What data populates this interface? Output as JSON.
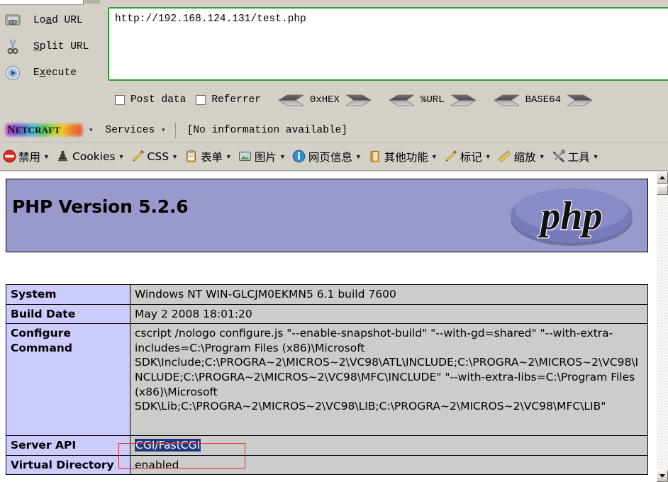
{
  "hackbar": {
    "actions": [
      {
        "icon": "load-url-icon",
        "label_pre": "Lo",
        "label_key": "a",
        "label_post": "d URL",
        "full": "Load URL"
      },
      {
        "icon": "split-url-scissors-icon",
        "label_pre": "",
        "label_key": "S",
        "label_post": "plit URL",
        "full": "Split URL"
      },
      {
        "icon": "execute-play-icon",
        "label_pre": "E",
        "label_key": "x",
        "label_post": "ecute",
        "full": "Execute"
      }
    ],
    "url_value": "http://192.168.124.131/test.php",
    "options": [
      {
        "label": "Post data",
        "checked": false
      },
      {
        "label": "Referrer",
        "checked": false
      }
    ],
    "encoders": [
      {
        "label": "0xHEX"
      },
      {
        "label": "%URL"
      },
      {
        "label": "BASE64"
      }
    ]
  },
  "netcraft": {
    "brand_first": "N",
    "brand_rest": "ETCRAFT",
    "menu": "Services",
    "status": "[No information available]"
  },
  "webdev_toolbar": {
    "items": [
      {
        "icon": "disable-prohibited-icon",
        "label": "禁用"
      },
      {
        "icon": "cookies-stamp-icon",
        "label": "Cookies"
      },
      {
        "icon": "css-pencil-icon",
        "label": "CSS"
      },
      {
        "icon": "forms-clipboard-icon",
        "label": "表单"
      },
      {
        "icon": "images-picture-icon",
        "label": "图片"
      },
      {
        "icon": "page-info-icon",
        "label": "网页信息"
      },
      {
        "icon": "misc-book-icon",
        "label": "其他功能"
      },
      {
        "icon": "outline-pencil-icon",
        "label": "标记"
      },
      {
        "icon": "resize-ruler-icon",
        "label": "缩放"
      },
      {
        "icon": "tools-wrench-icon",
        "label": "工具"
      }
    ]
  },
  "phpinfo": {
    "banner_title": "PHP Version 5.2.6",
    "logo_text": "php",
    "rows": [
      {
        "key": "System",
        "value": "Windows NT WIN-GLCJM0EKMN5 6.1 build 7600",
        "selected": false
      },
      {
        "key": "Build Date",
        "value": "May 2 2008 18:01:20",
        "selected": false
      },
      {
        "key": "Configure Command",
        "value": "cscript /nologo configure.js \"--enable-snapshot-build\" \"--with-gd=shared\" \"--with-extra-includes=C:\\Program Files (x86)\\Microsoft SDK\\Include;C:\\PROGRA~2\\MICROS~2\\VC98\\ATL\\INCLUDE;C:\\PROGRA~2\\MICROS~2\\VC98\\INCLUDE;C:\\PROGRA~2\\MICROS~2\\VC98\\MFC\\INCLUDE\" \"--with-extra-libs=C:\\Program Files (x86)\\Microsoft SDK\\Lib;C:\\PROGRA~2\\MICROS~2\\VC98\\LIB;C:\\PROGRA~2\\MICROS~2\\VC98\\MFC\\LIB\"",
        "selected": false
      },
      {
        "key": "Server API",
        "value": "CGI/FastCGI",
        "selected": true
      },
      {
        "key": "Virtual Directory",
        "value": "enabled",
        "selected": false
      }
    ]
  },
  "colors": {
    "banner_bg": "#9999cc",
    "key_cell_bg": "#ccccff",
    "value_cell_bg": "#cccccc",
    "chrome_bg": "#d4d0c8",
    "url_border": "#2f9e2f",
    "selection_bg": "#1f3a7a",
    "annotation_red": "#e8262b"
  },
  "scrollbar": {
    "up_glyph": "▲",
    "down_glyph": "▼",
    "position_percent": 4
  }
}
